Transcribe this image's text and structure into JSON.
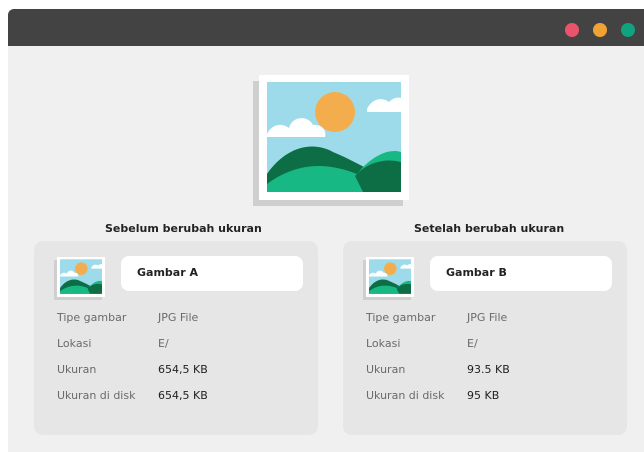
{
  "window": {
    "dots": [
      {
        "name": "red",
        "color": "#e9546b"
      },
      {
        "name": "yellow",
        "color": "#f0a234"
      },
      {
        "name": "green",
        "color": "#10a37f"
      }
    ]
  },
  "colors": {
    "sky": "#9edbea",
    "sun": "#f4ad4c",
    "hill_dark": "#0d6e46",
    "hill_light": "#18b884"
  },
  "before": {
    "caption": "Sebelum berubah ukuran",
    "name": "Gambar A",
    "rows": [
      {
        "label": "Tipe gambar",
        "value": "JPG File"
      },
      {
        "label": "Lokasi",
        "value": "E/"
      },
      {
        "label": "Ukuran",
        "value": "654,5 KB"
      },
      {
        "label": "Ukuran di disk",
        "value": "654,5 KB"
      }
    ]
  },
  "after": {
    "caption": "Setelah berubah ukuran",
    "name": "Gambar B",
    "rows": [
      {
        "label": "Tipe gambar",
        "value": "JPG File"
      },
      {
        "label": "Lokasi",
        "value": "E/"
      },
      {
        "label": "Ukuran",
        "value": "93.5 KB"
      },
      {
        "label": "Ukuran di disk",
        "value": "95 KB"
      }
    ]
  }
}
